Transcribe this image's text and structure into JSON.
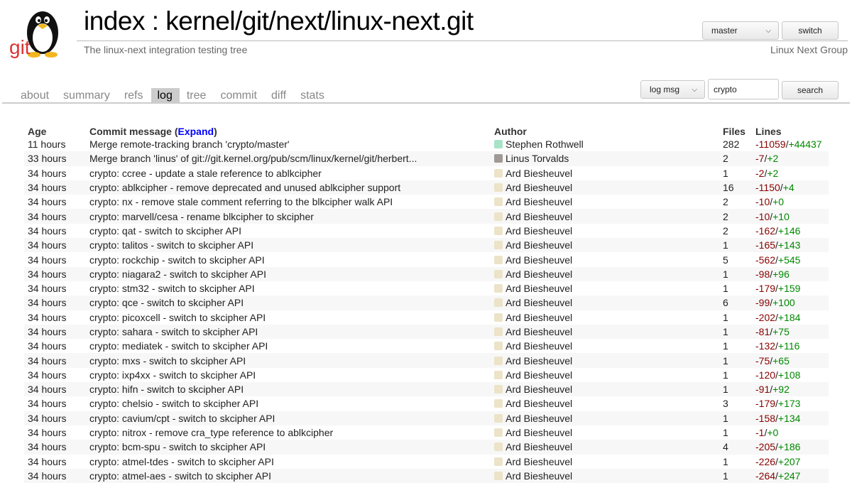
{
  "header": {
    "logo_text": "git",
    "title_prefix": "index : ",
    "repo": "kernel/git/next/linux-next.git",
    "description": "The linux-next integration testing tree",
    "owner": "Linux Next Group",
    "branch_select": "master",
    "switch_label": "switch"
  },
  "tabs": [
    "about",
    "summary",
    "refs",
    "log",
    "tree",
    "commit",
    "diff",
    "stats"
  ],
  "active_tab": "log",
  "search": {
    "mode": "log msg",
    "query": "crypto",
    "button": "search"
  },
  "table": {
    "headers": {
      "age": "Age",
      "message": "Commit message (",
      "expand": "Expand",
      "message_close": ")",
      "author": "Author",
      "files": "Files",
      "lines": "Lines"
    },
    "rows": [
      {
        "age": "11 hours",
        "msg": "Merge remote-tracking branch 'crypto/master'",
        "author": "Stephen Rothwell",
        "avatar": "sr",
        "files": "282",
        "del": "-11059",
        "add": "+44437"
      },
      {
        "age": "33 hours",
        "msg": "Merge branch 'linus' of git://git.kernel.org/pub/scm/linux/kernel/git/herbert...",
        "author": "Linus Torvalds",
        "avatar": "lt",
        "files": "2",
        "del": "-7",
        "add": "+2"
      },
      {
        "age": "34 hours",
        "msg": "crypto: ccree - update a stale reference to ablkcipher",
        "author": "Ard Biesheuvel",
        "avatar": "ard",
        "files": "1",
        "del": "-2",
        "add": "+2"
      },
      {
        "age": "34 hours",
        "msg": "crypto: ablkcipher - remove deprecated and unused ablkcipher support",
        "author": "Ard Biesheuvel",
        "avatar": "ard",
        "files": "16",
        "del": "-1150",
        "add": "+4"
      },
      {
        "age": "34 hours",
        "msg": "crypto: nx - remove stale comment referring to the blkcipher walk API",
        "author": "Ard Biesheuvel",
        "avatar": "ard",
        "files": "2",
        "del": "-10",
        "add": "+0"
      },
      {
        "age": "34 hours",
        "msg": "crypto: marvell/cesa - rename blkcipher to skcipher",
        "author": "Ard Biesheuvel",
        "avatar": "ard",
        "files": "2",
        "del": "-10",
        "add": "+10"
      },
      {
        "age": "34 hours",
        "msg": "crypto: qat - switch to skcipher API",
        "author": "Ard Biesheuvel",
        "avatar": "ard",
        "files": "2",
        "del": "-162",
        "add": "+146"
      },
      {
        "age": "34 hours",
        "msg": "crypto: talitos - switch to skcipher API",
        "author": "Ard Biesheuvel",
        "avatar": "ard",
        "files": "1",
        "del": "-165",
        "add": "+143"
      },
      {
        "age": "34 hours",
        "msg": "crypto: rockchip - switch to skcipher API",
        "author": "Ard Biesheuvel",
        "avatar": "ard",
        "files": "5",
        "del": "-562",
        "add": "+545"
      },
      {
        "age": "34 hours",
        "msg": "crypto: niagara2 - switch to skcipher API",
        "author": "Ard Biesheuvel",
        "avatar": "ard",
        "files": "1",
        "del": "-98",
        "add": "+96"
      },
      {
        "age": "34 hours",
        "msg": "crypto: stm32 - switch to skcipher API",
        "author": "Ard Biesheuvel",
        "avatar": "ard",
        "files": "1",
        "del": "-179",
        "add": "+159"
      },
      {
        "age": "34 hours",
        "msg": "crypto: qce - switch to skcipher API",
        "author": "Ard Biesheuvel",
        "avatar": "ard",
        "files": "6",
        "del": "-99",
        "add": "+100"
      },
      {
        "age": "34 hours",
        "msg": "crypto: picoxcell - switch to skcipher API",
        "author": "Ard Biesheuvel",
        "avatar": "ard",
        "files": "1",
        "del": "-202",
        "add": "+184"
      },
      {
        "age": "34 hours",
        "msg": "crypto: sahara - switch to skcipher API",
        "author": "Ard Biesheuvel",
        "avatar": "ard",
        "files": "1",
        "del": "-81",
        "add": "+75"
      },
      {
        "age": "34 hours",
        "msg": "crypto: mediatek - switch to skcipher API",
        "author": "Ard Biesheuvel",
        "avatar": "ard",
        "files": "1",
        "del": "-132",
        "add": "+116"
      },
      {
        "age": "34 hours",
        "msg": "crypto: mxs - switch to skcipher API",
        "author": "Ard Biesheuvel",
        "avatar": "ard",
        "files": "1",
        "del": "-75",
        "add": "+65"
      },
      {
        "age": "34 hours",
        "msg": "crypto: ixp4xx - switch to skcipher API",
        "author": "Ard Biesheuvel",
        "avatar": "ard",
        "files": "1",
        "del": "-120",
        "add": "+108"
      },
      {
        "age": "34 hours",
        "msg": "crypto: hifn - switch to skcipher API",
        "author": "Ard Biesheuvel",
        "avatar": "ard",
        "files": "1",
        "del": "-91",
        "add": "+92"
      },
      {
        "age": "34 hours",
        "msg": "crypto: chelsio - switch to skcipher API",
        "author": "Ard Biesheuvel",
        "avatar": "ard",
        "files": "3",
        "del": "-179",
        "add": "+173"
      },
      {
        "age": "34 hours",
        "msg": "crypto: cavium/cpt - switch to skcipher API",
        "author": "Ard Biesheuvel",
        "avatar": "ard",
        "files": "1",
        "del": "-158",
        "add": "+134"
      },
      {
        "age": "34 hours",
        "msg": "crypto: nitrox - remove cra_type reference to ablkcipher",
        "author": "Ard Biesheuvel",
        "avatar": "ard",
        "files": "1",
        "del": "-1",
        "add": "+0"
      },
      {
        "age": "34 hours",
        "msg": "crypto: bcm-spu - switch to skcipher API",
        "author": "Ard Biesheuvel",
        "avatar": "ard",
        "files": "4",
        "del": "-205",
        "add": "+186"
      },
      {
        "age": "34 hours",
        "msg": "crypto: atmel-tdes - switch to skcipher API",
        "author": "Ard Biesheuvel",
        "avatar": "ard",
        "files": "1",
        "del": "-226",
        "add": "+207"
      },
      {
        "age": "34 hours",
        "msg": "crypto: atmel-aes - switch to skcipher API",
        "author": "Ard Biesheuvel",
        "avatar": "ard",
        "files": "1",
        "del": "-264",
        "add": "+247"
      }
    ]
  }
}
